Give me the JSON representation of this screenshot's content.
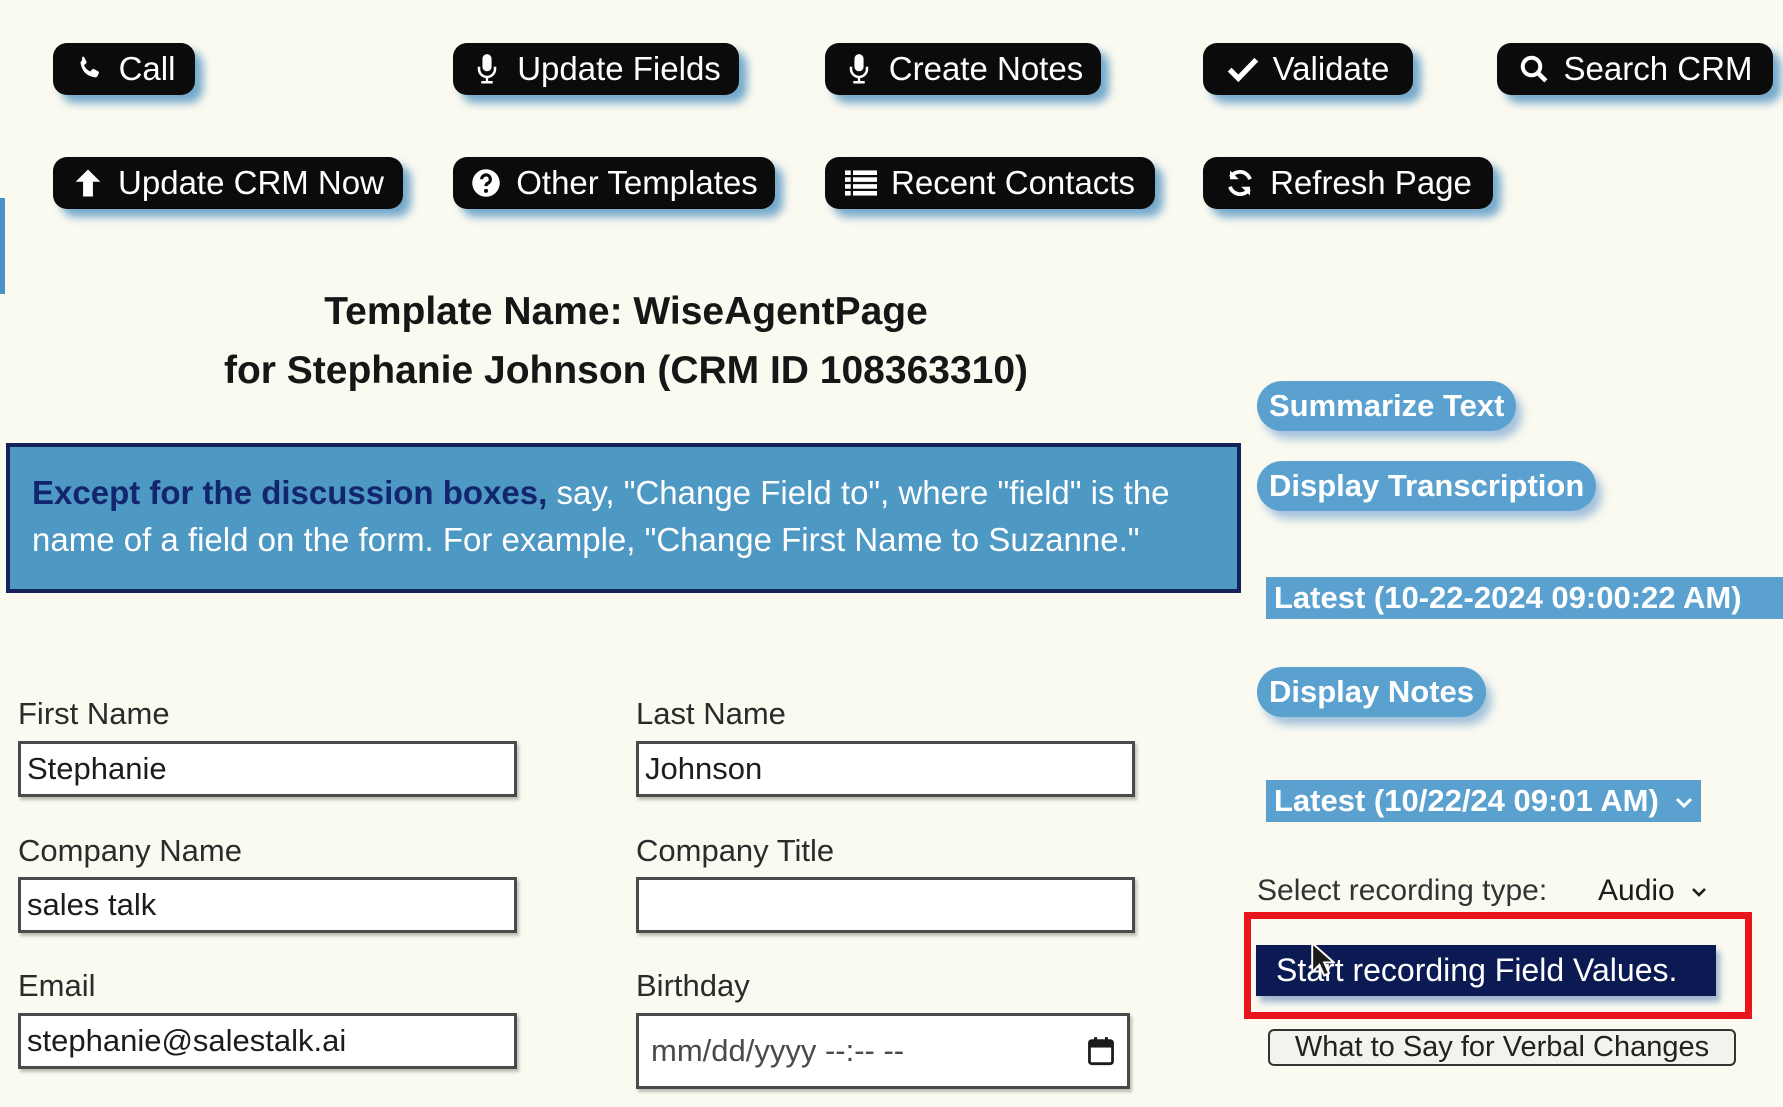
{
  "toolbar": {
    "call": {
      "label": "Call",
      "icon": "phone-icon"
    },
    "update_fields": {
      "label": "Update Fields",
      "icon": "microphone-icon"
    },
    "create_notes": {
      "label": "Create Notes",
      "icon": "microphone-icon"
    },
    "validate": {
      "label": "Validate",
      "icon": "checkmark-icon"
    },
    "search_crm": {
      "label": "Search CRM",
      "icon": "search-icon"
    },
    "update_crm_now": {
      "label": "Update CRM Now",
      "icon": "arrow-up-icon"
    },
    "other_templates": {
      "label": "Other Templates",
      "icon": "question-circle-icon"
    },
    "recent_contacts": {
      "label": "Recent Contacts",
      "icon": "list-icon"
    },
    "refresh_page": {
      "label": "Refresh Page",
      "icon": "refresh-icon"
    }
  },
  "header": {
    "template_line": "Template Name: WiseAgentPage",
    "contact_line": "for Stephanie Johnson (CRM ID 108363310)"
  },
  "instructions": {
    "lead": "Except for the discussion boxes,",
    "body": "say, \"Change Field to\", where \"field\" is the name of a field on the form. For example, \"Change First Name to Suzanne.\""
  },
  "side_panel": {
    "summarize_text": "Summarize Text",
    "display_transcription": "Display Transcription",
    "transcription_version": "Latest (10-22-2024 09:00:22 AM)",
    "display_notes": "Display Notes",
    "notes_version": "Latest (10/22/24 09:01 AM)",
    "recording_type_label": "Select recording type:",
    "recording_type_value": "Audio",
    "start_recording": "Start recording Field Values.",
    "verbal_changes": "What to Say for Verbal Changes"
  },
  "form": {
    "first_name": {
      "label": "First Name",
      "value": "Stephanie"
    },
    "last_name": {
      "label": "Last Name",
      "value": "Johnson"
    },
    "company_name": {
      "label": "Company Name",
      "value": "sales talk"
    },
    "company_title": {
      "label": "Company Title",
      "value": ""
    },
    "email": {
      "label": "Email",
      "value": "stephanie@salestalk.ai"
    },
    "birthday": {
      "label": "Birthday",
      "placeholder": "mm/dd/yyyy --:-- --",
      "icon": "calendar-icon"
    }
  },
  "colors": {
    "page_background": "#fbfaf1",
    "toolbar_button": "#0b0b0b",
    "instruction_box": "#4e98c4",
    "instruction_lead": "#12256e",
    "accent_blue": "#5aa1d0",
    "start_button": "#0c1a54",
    "highlight_frame": "#e8151c"
  }
}
